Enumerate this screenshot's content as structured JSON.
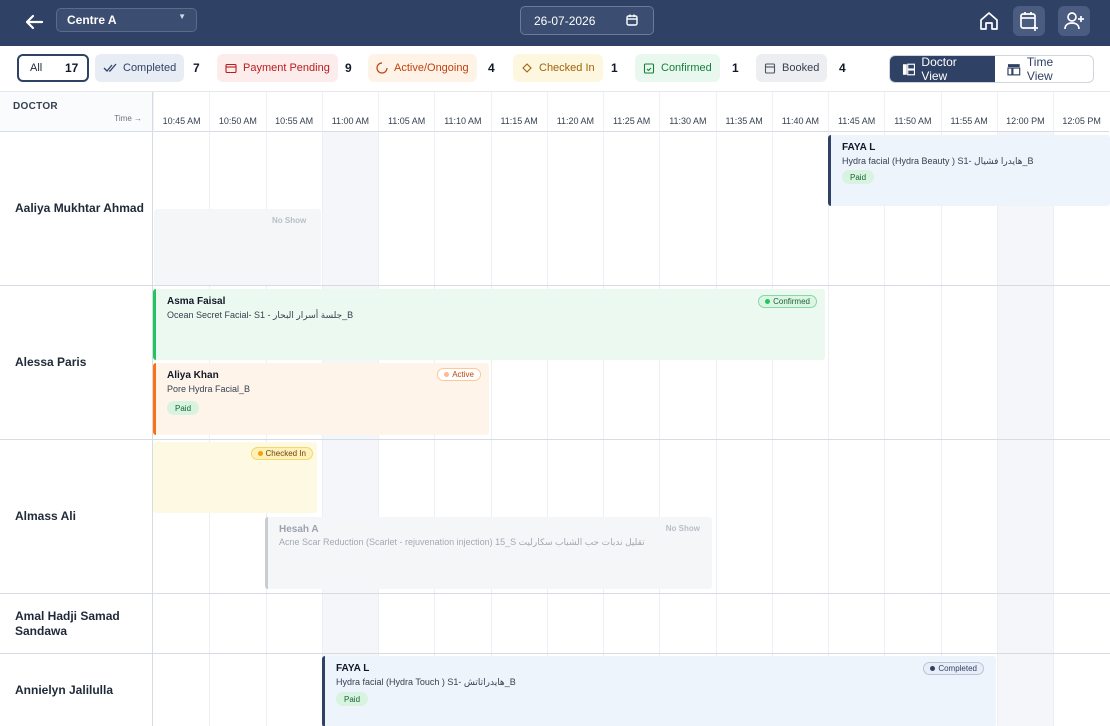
{
  "header": {
    "centre": "Centre A",
    "date": "26-07-2026"
  },
  "filters": {
    "all": {
      "label": "All",
      "count": "17"
    },
    "completed": {
      "label": "Completed",
      "count": "7"
    },
    "payment_pending": {
      "label": "Payment Pending",
      "count": "9"
    },
    "active": {
      "label": "Active/Ongoing",
      "count": "4"
    },
    "checked_in": {
      "label": "Checked In",
      "count": "1"
    },
    "confirmed": {
      "label": "Confirmed",
      "count": "1"
    },
    "booked": {
      "label": "Booked",
      "count": "4"
    }
  },
  "views": {
    "doctor": "Doctor View",
    "time": "Time View"
  },
  "grid": {
    "doctor_header": "DOCTOR",
    "time_header": "Time →",
    "times": [
      "10:45 AM",
      "10:50 AM",
      "10:55 AM",
      "11:00 AM",
      "11:05 AM",
      "11:10 AM",
      "11:15 AM",
      "11:20 AM",
      "11:25 AM",
      "11:30 AM",
      "11:35 AM",
      "11:40 AM",
      "11:45 AM",
      "11:50 AM",
      "11:55 AM",
      "12:00 PM",
      "12:05 PM"
    ]
  },
  "doctors": [
    {
      "name": "Aaliya Mukhtar Ahmad"
    },
    {
      "name": "Alessa Paris"
    },
    {
      "name": "Almass Ali"
    },
    {
      "name": "Amal Hadji Samad Sandawa"
    },
    {
      "name": "Annielyn Jalilulla"
    }
  ],
  "appointments": {
    "a1": {
      "patient": "FAYA L",
      "service": "Hydra facial (Hydra Beauty ) S1- هايدرا فشيال_B",
      "payment": "Paid"
    },
    "a1_noshow": {
      "label": "No Show"
    },
    "a2": {
      "patient": "Asma Faisal",
      "service": "Ocean Secret Facial- S1 - جلسة أسرار البحار_B",
      "status": "Confirmed"
    },
    "a3": {
      "patient": "Aliya Khan",
      "service": "Pore Hydra Facial_B",
      "status": "Active",
      "payment": "Paid"
    },
    "a4": {
      "status": "Checked In"
    },
    "a5": {
      "patient": "Hesah A",
      "service": "Acne Scar Reduction (Scarlet - rejuvenation injection) 15_S تقليل ندبات حب الشباب سكارليت",
      "noshow": "No Show"
    },
    "a6": {
      "patient": "FAYA L",
      "service": "Hydra facial (Hydra Touch ) S1- هايدراتاتش_B",
      "status": "Completed",
      "payment": "Paid"
    }
  },
  "colors": {
    "header_bg": "#2f4164",
    "confirmed": "#22c55e",
    "active": "#f97316",
    "checked_in": "#facc15",
    "completed": "#2f4164"
  }
}
